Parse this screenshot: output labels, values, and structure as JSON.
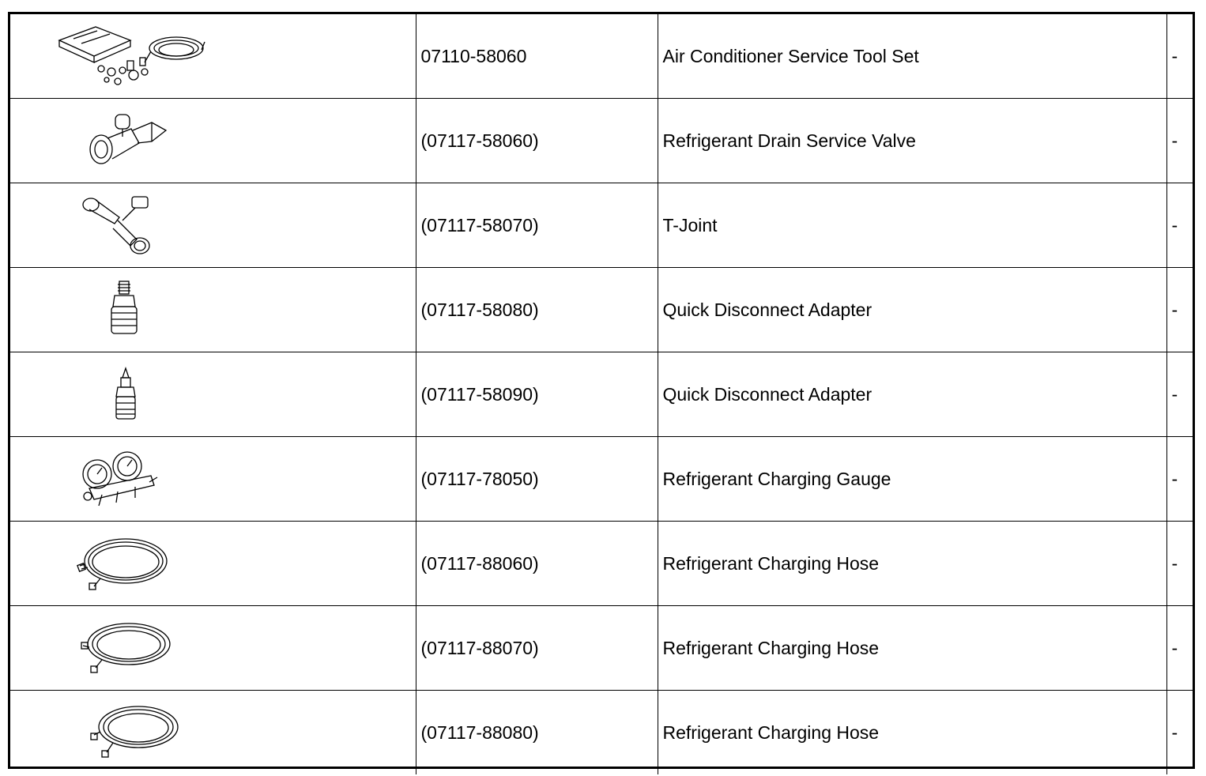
{
  "rows": [
    {
      "icon": "service-tool-set-icon",
      "part_no": "07110-58060",
      "name": "Air Conditioner Service Tool Set",
      "note": "-"
    },
    {
      "icon": "drain-service-valve-icon",
      "part_no": "(07117-58060)",
      "name": "Refrigerant Drain Service Valve",
      "note": "-"
    },
    {
      "icon": "t-joint-icon",
      "part_no": "(07117-58070)",
      "name": "T-Joint",
      "note": "-"
    },
    {
      "icon": "quick-disconnect-adapter-icon",
      "part_no": "(07117-58080)",
      "name": "Quick Disconnect Adapter",
      "note": "-"
    },
    {
      "icon": "quick-disconnect-adapter-icon",
      "part_no": "(07117-58090)",
      "name": "Quick Disconnect Adapter",
      "note": "-"
    },
    {
      "icon": "charging-gauge-icon",
      "part_no": "(07117-78050)",
      "name": "Refrigerant Charging Gauge",
      "note": "-"
    },
    {
      "icon": "charging-hose-icon",
      "part_no": "(07117-88060)",
      "name": "Refrigerant Charging Hose",
      "note": "-"
    },
    {
      "icon": "charging-hose-icon",
      "part_no": "(07117-88070)",
      "name": "Refrigerant Charging Hose",
      "note": "-"
    },
    {
      "icon": "charging-hose-icon",
      "part_no": "(07117-88080)",
      "name": "Refrigerant Charging Hose",
      "note": "-"
    }
  ]
}
